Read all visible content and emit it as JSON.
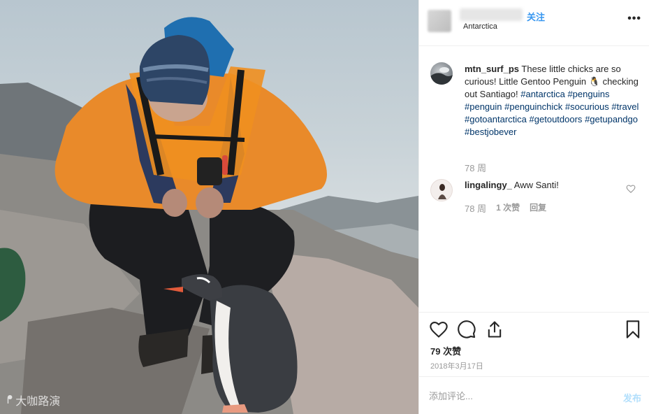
{
  "header": {
    "follow_label": "关注",
    "location": "Antarctica",
    "more_label": "•••"
  },
  "caption": {
    "username": "mtn_surf_ps",
    "text": " These little chicks are so curious! Little Gentoo Penguin 🐧 checking out Santiago! ",
    "hashtags": [
      "#antarctica",
      "#penguins",
      "#penguin",
      "#penguinchick",
      "#socurious",
      "#travel",
      "#gotoantarctica",
      "#getoutdoors",
      "#getupandgo",
      "#bestjobever"
    ],
    "time": "78 周"
  },
  "comment": {
    "username": "lingalingy_",
    "text": " Aww Santi!",
    "time": "78 周",
    "likes": "1 次赞",
    "reply": "回复"
  },
  "post": {
    "likes": "79 次赞",
    "date": "2018年3月17日"
  },
  "add_comment": {
    "placeholder": "添加评论...",
    "post_label": "发布"
  },
  "watermark": "大咖路演"
}
